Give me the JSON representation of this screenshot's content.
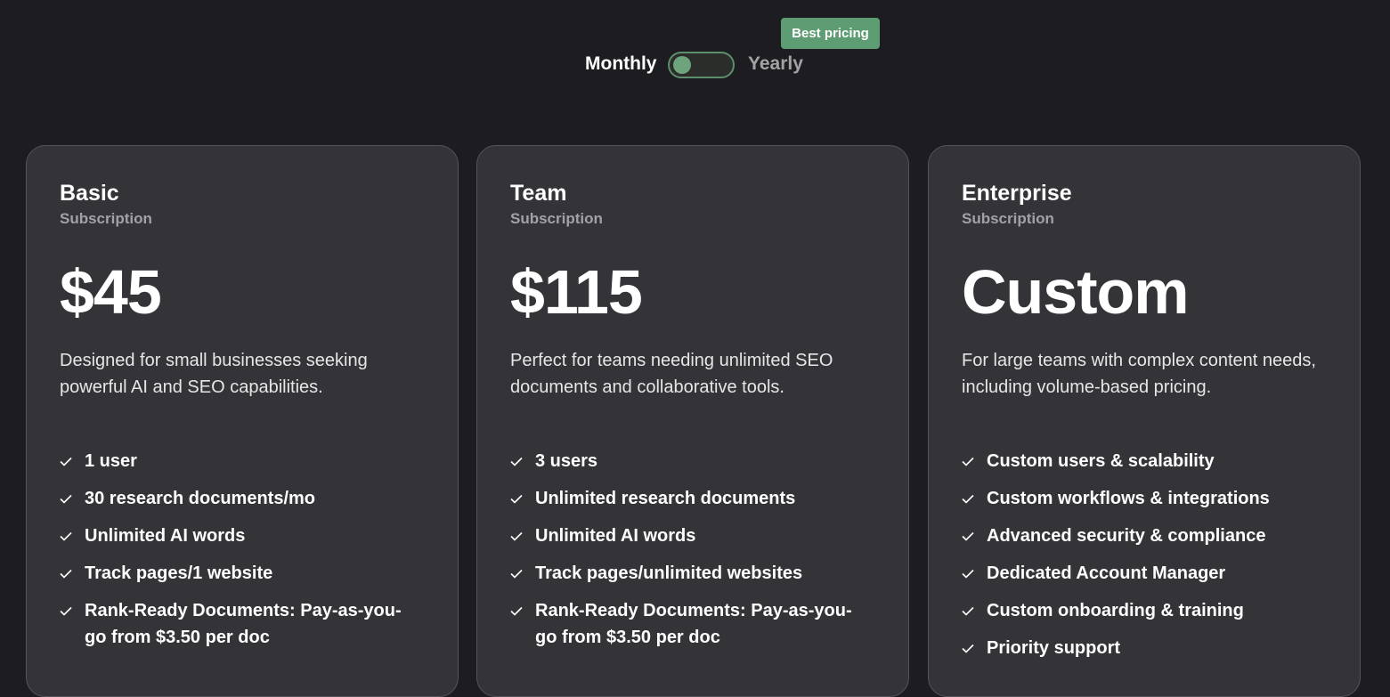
{
  "billing_toggle": {
    "monthly_label": "Monthly",
    "yearly_label": "Yearly",
    "selected": "Monthly",
    "badge": "Best pricing"
  },
  "colors": {
    "background": "#1d1c20",
    "card": "#343338",
    "accent": "#5e9d74"
  },
  "plans": [
    {
      "name": "Basic",
      "type": "Subscription",
      "price": "$45",
      "description": "Designed for small businesses seeking powerful AI and SEO capabilities.",
      "features": [
        "1 user",
        "30 research documents/mo",
        "Unlimited AI words",
        "Track pages/1 website",
        "Rank-Ready Documents: Pay-as-you-go from $3.50 per doc"
      ]
    },
    {
      "name": "Team",
      "type": "Subscription",
      "price": "$115",
      "description": "Perfect for teams needing unlimited SEO documents and collaborative tools.",
      "features": [
        "3 users",
        "Unlimited research documents",
        "Unlimited AI words",
        "Track pages/unlimited websites",
        "Rank-Ready Documents: Pay-as-you-go from $3.50 per doc"
      ]
    },
    {
      "name": "Enterprise",
      "type": "Subscription",
      "price": "Custom",
      "description": "For large teams with complex content needs, including volume-based pricing.",
      "features": [
        "Custom users & scalability",
        "Custom workflows & integrations",
        "Advanced security & compliance",
        "Dedicated Account Manager",
        "Custom onboarding & training",
        "Priority support"
      ]
    }
  ]
}
